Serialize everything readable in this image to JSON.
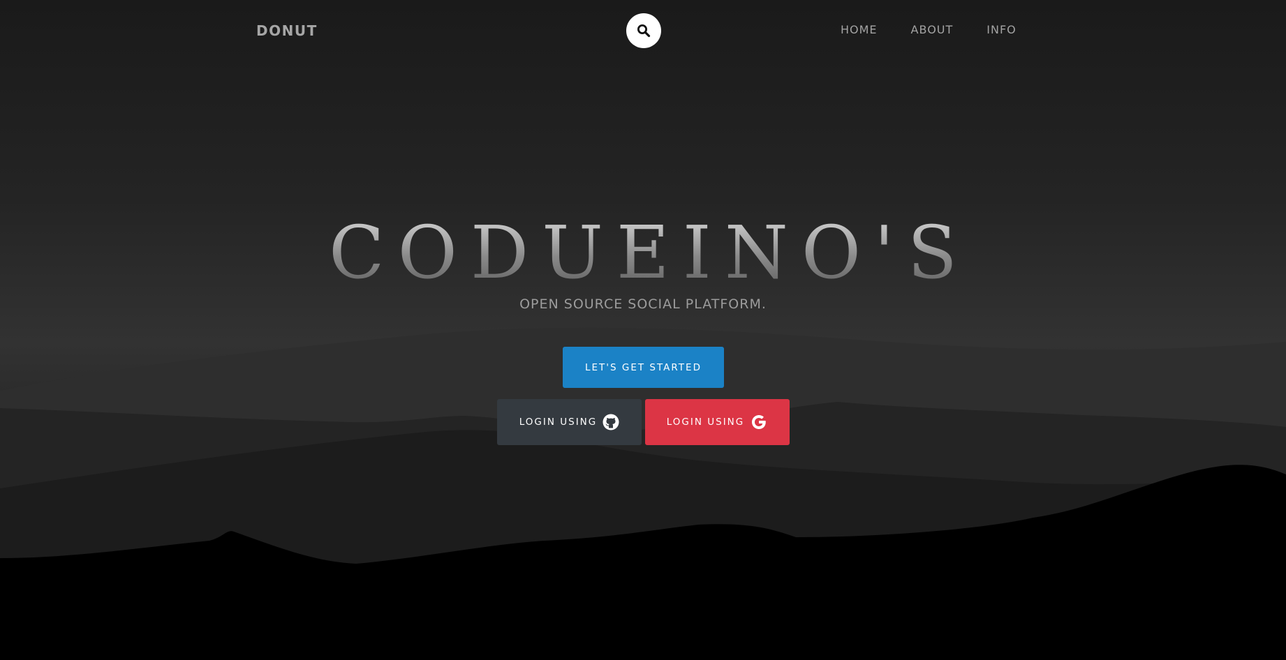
{
  "nav": {
    "brand": "DONUT",
    "search_icon": "search-icon",
    "links": [
      {
        "label": "HOME"
      },
      {
        "label": "ABOUT"
      },
      {
        "label": "INFO"
      }
    ]
  },
  "hero": {
    "title": "CODUEINO'S",
    "subtitle": "OPEN SOURCE SOCIAL PLATFORM.",
    "start_button": "LET'S GET STARTED",
    "github_button": "LOGIN USING",
    "github_icon": "github-icon",
    "google_button": "LOGIN USING",
    "google_icon": "google-icon"
  },
  "colors": {
    "start_button": "#1b82c6",
    "github_button": "#343a40",
    "google_button": "#dc3545",
    "background_top": "#1a1a1a",
    "background_bottom": "#000000"
  }
}
